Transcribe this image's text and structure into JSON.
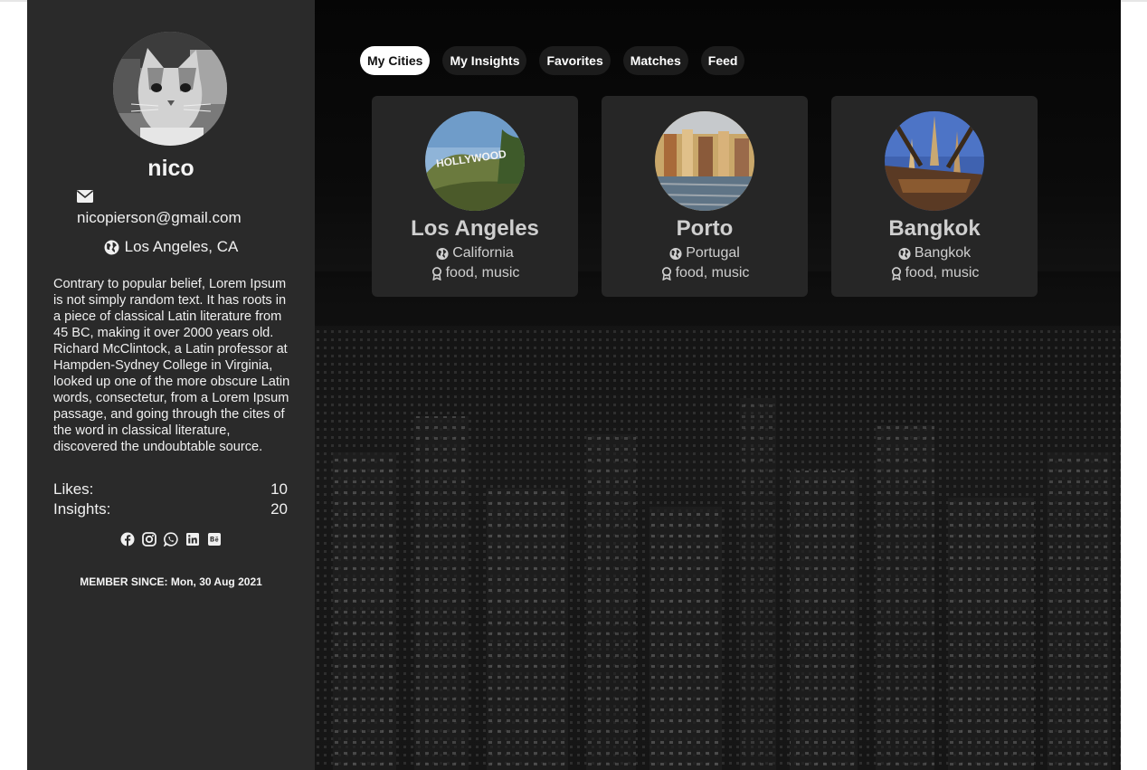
{
  "profile": {
    "username": "nico",
    "email": "nicopierson@gmail.com",
    "location": "Los Angeles, CA",
    "bio": "Contrary to popular belief, Lorem Ipsum is not simply random text. It has roots in a piece of classical Latin literature from 45 BC, making it over 2000 years old. Richard McClintock, a Latin professor at Hampden-Sydney College in Virginia, looked up one of the more obscure Latin words, consectetur, from a Lorem Ipsum passage, and going through the cites of the word in classical literature, discovered the undoubtable source.",
    "likes_label": "Likes:",
    "likes_value": "10",
    "insights_label": "Insights:",
    "insights_value": "20",
    "member_since": "MEMBER SINCE: Mon, 30 Aug 2021",
    "social_icons": [
      "facebook-icon",
      "instagram-icon",
      "whatsapp-icon",
      "linkedin-icon",
      "behance-icon"
    ]
  },
  "tabs": [
    {
      "label": "My Cities",
      "active": true
    },
    {
      "label": "My Insights",
      "active": false
    },
    {
      "label": "Favorites",
      "active": false
    },
    {
      "label": "Matches",
      "active": false
    },
    {
      "label": "Feed",
      "active": false
    }
  ],
  "cities": [
    {
      "name": "Los Angeles",
      "region": "California",
      "tags": "food, music"
    },
    {
      "name": "Porto",
      "region": "Portugal",
      "tags": "food, music"
    },
    {
      "name": "Bangkok",
      "region": "Bangkok",
      "tags": "food, music"
    }
  ],
  "colors": {
    "sidebar_bg": "#2a2a2a",
    "card_bg": "#262626",
    "tab_bg": "#1c1c1c",
    "tab_active_bg": "#ffffff"
  }
}
